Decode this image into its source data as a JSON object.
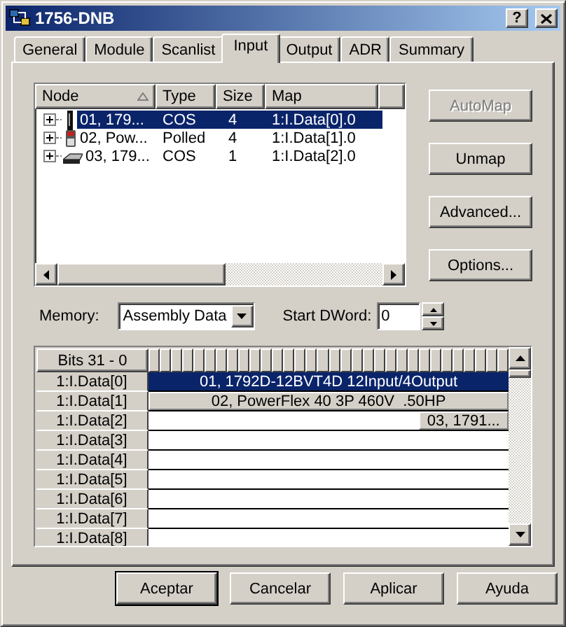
{
  "window": {
    "title": "1756-DNB",
    "help_button": "?"
  },
  "tabs": [
    {
      "label": "General",
      "selected": false
    },
    {
      "label": "Module",
      "selected": false
    },
    {
      "label": "Scanlist",
      "selected": false
    },
    {
      "label": "Input",
      "selected": true
    },
    {
      "label": "Output",
      "selected": false
    },
    {
      "label": "ADR",
      "selected": false
    },
    {
      "label": "Summary",
      "selected": false
    }
  ],
  "node_list": {
    "columns": [
      "Node",
      "Type",
      "Size",
      "Map"
    ],
    "rows": [
      {
        "kind": "module",
        "node": "01, 179...",
        "type": "COS",
        "size": "4",
        "map": "1:I.Data[0].0",
        "selected": true,
        "expanded": false
      },
      {
        "kind": "drive",
        "node": "02, Pow...",
        "type": "Polled",
        "size": "4",
        "map": "1:I.Data[1].0",
        "selected": false,
        "expanded": false
      },
      {
        "kind": "block",
        "node": "03, 179...",
        "type": "COS",
        "size": "1",
        "map": "1:I.Data[2].0",
        "selected": false,
        "expanded": false
      }
    ]
  },
  "side_buttons": [
    {
      "label": "AutoMap",
      "disabled": true
    },
    {
      "label": "Unmap",
      "disabled": false
    },
    {
      "label": "Advanced...",
      "disabled": false
    },
    {
      "label": "Options...",
      "disabled": false
    }
  ],
  "memory": {
    "label": "Memory:",
    "value": "Assembly Data"
  },
  "start_dword": {
    "label": "Start DWord:",
    "value": "0"
  },
  "map_grid": {
    "header": "Bits 31 - 0",
    "rows": [
      {
        "label": "1:I.Data[0]",
        "entries": [
          {
            "text": "01, 1792D-12BVT4D 12Input/4Output",
            "kind": "word",
            "selected": true
          }
        ]
      },
      {
        "label": "1:I.Data[1]",
        "entries": [
          {
            "text": "02, PowerFlex 40 3P 460V  .50HP",
            "kind": "word",
            "selected": false
          }
        ]
      },
      {
        "label": "1:I.Data[2]",
        "entries": [
          {
            "text": "03, 1791...",
            "kind": "byte",
            "selected": false
          }
        ]
      },
      {
        "label": "1:I.Data[3]"
      },
      {
        "label": "1:I.Data[4]"
      },
      {
        "label": "1:I.Data[5]"
      },
      {
        "label": "1:I.Data[6]"
      },
      {
        "label": "1:I.Data[7]"
      },
      {
        "label": "1:I.Data[8]"
      }
    ]
  },
  "footer_buttons": [
    {
      "label": "Aceptar",
      "default": true
    },
    {
      "label": "Cancelar",
      "default": false
    },
    {
      "label": "Aplicar",
      "default": false
    },
    {
      "label": "Ayuda",
      "default": false
    }
  ]
}
